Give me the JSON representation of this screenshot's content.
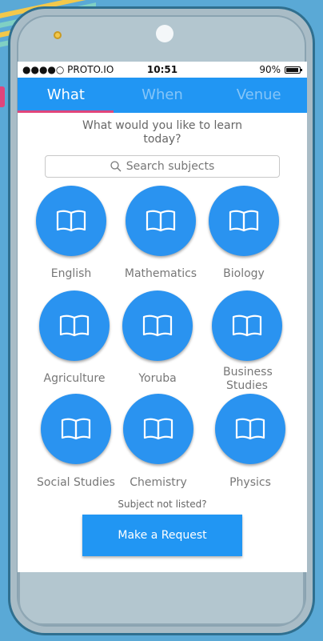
{
  "status_bar": {
    "carrier": "●●●●○ PROTO.IO",
    "time": "10:51",
    "battery": "90%"
  },
  "tabs": [
    {
      "label": "What",
      "active": true
    },
    {
      "label": "When",
      "active": false
    },
    {
      "label": "Venue",
      "active": false
    }
  ],
  "prompt": "What would you like to learn today?",
  "search": {
    "placeholder": "Search subjects",
    "icon": "search-icon"
  },
  "subjects": [
    {
      "label": "English",
      "icon": "book-icon"
    },
    {
      "label": "Mathematics",
      "icon": "book-icon"
    },
    {
      "label": "Biology",
      "icon": "book-icon"
    },
    {
      "label": "Agriculture",
      "icon": "book-icon"
    },
    {
      "label": "Yoruba",
      "icon": "book-icon"
    },
    {
      "label": "Business Studies",
      "icon": "book-icon"
    },
    {
      "label": "Social Studies",
      "icon": "book-icon"
    },
    {
      "label": "Chemistry",
      "icon": "book-icon"
    },
    {
      "label": "Physics",
      "icon": "book-icon"
    }
  ],
  "subject_not_listed": "Subject not listed?",
  "request_button": "Make a Request",
  "colors": {
    "accent": "#2196f3",
    "tab_indicator": "#e0457b",
    "background": "#5aa9d6"
  }
}
